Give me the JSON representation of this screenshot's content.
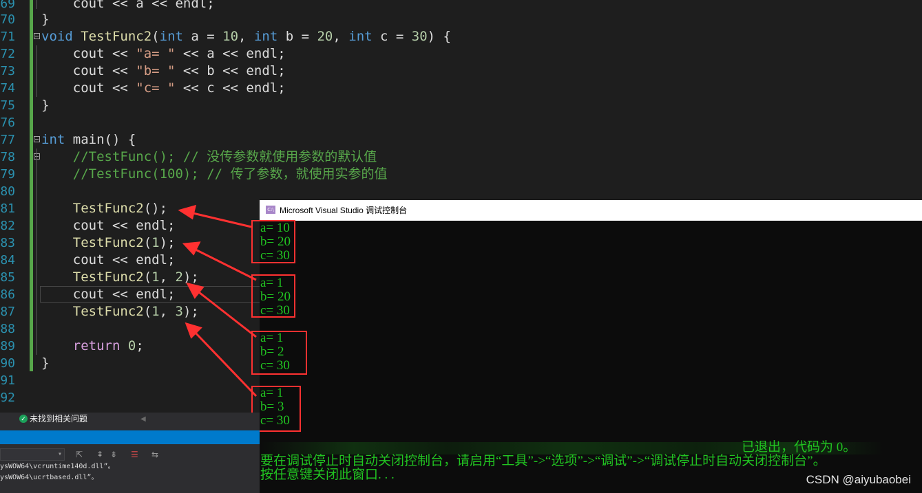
{
  "editor": {
    "lines": [
      {
        "no": "69",
        "code": "    cout << a << endl;"
      },
      {
        "no": "70",
        "code": "}"
      },
      {
        "no": "71",
        "code": "void TestFunc2(int a = 10, int b = 20, int c = 30) {"
      },
      {
        "no": "72",
        "code": "    cout << \"a= \" << a << endl;"
      },
      {
        "no": "73",
        "code": "    cout << \"b= \" << b << endl;"
      },
      {
        "no": "74",
        "code": "    cout << \"c= \" << c << endl;"
      },
      {
        "no": "75",
        "code": "}"
      },
      {
        "no": "76",
        "code": ""
      },
      {
        "no": "77",
        "code": "int main() {"
      },
      {
        "no": "78",
        "code": "    //TestFunc(); // 没传参数就使用参数的默认值"
      },
      {
        "no": "79",
        "code": "    //TestFunc(100); // 传了参数，就使用实参的值"
      },
      {
        "no": "80",
        "code": ""
      },
      {
        "no": "81",
        "code": "    TestFunc2();"
      },
      {
        "no": "82",
        "code": "    cout << endl;"
      },
      {
        "no": "83",
        "code": "    TestFunc2(1);"
      },
      {
        "no": "84",
        "code": "    cout << endl;"
      },
      {
        "no": "85",
        "code": "    TestFunc2(1, 2);"
      },
      {
        "no": "86",
        "code": "    cout << endl;"
      },
      {
        "no": "87",
        "code": "    TestFunc2(1, 3);"
      },
      {
        "no": "88",
        "code": ""
      },
      {
        "no": "89",
        "code": "    return 0;"
      },
      {
        "no": "90",
        "code": "}"
      },
      {
        "no": "91",
        "code": ""
      },
      {
        "no": "92",
        "code": ""
      }
    ]
  },
  "console": {
    "icon_text": "C:\\",
    "title": "Microsoft Visual Studio 调试控制台",
    "outputs": [
      [
        "a= 10",
        "b= 20",
        "c= 30"
      ],
      [
        "a= 1",
        "b= 20",
        "c= 30"
      ],
      [
        "a= 1",
        "b= 2",
        "c= 30"
      ],
      [
        "a= 1",
        "b= 3",
        "c= 30"
      ]
    ],
    "exit_line": "已退出，代码为 0。",
    "hint_line": "要在调试停止时自动关闭控制台，请启用“工具”->“选项”->“调试”->“调试停止时自动关闭控制台”。",
    "close_line": "按任意键关闭此窗口. . ."
  },
  "bottom_panel": {
    "issues_text": "未找到相关问题",
    "output_lines": [
      "ysWOW64\\vcruntime140d.dll”。",
      "ysWOW64\\ucrtbased.dll”。"
    ]
  },
  "watermark": "CSDN @aiyubaobei",
  "colors": {
    "keyword": "#569cd6",
    "function": "#dcdcaa",
    "string": "#d69d85",
    "number": "#b5cea8",
    "comment": "#57a64a",
    "console_text": "#21c421",
    "annotation_red": "#ff3131"
  }
}
